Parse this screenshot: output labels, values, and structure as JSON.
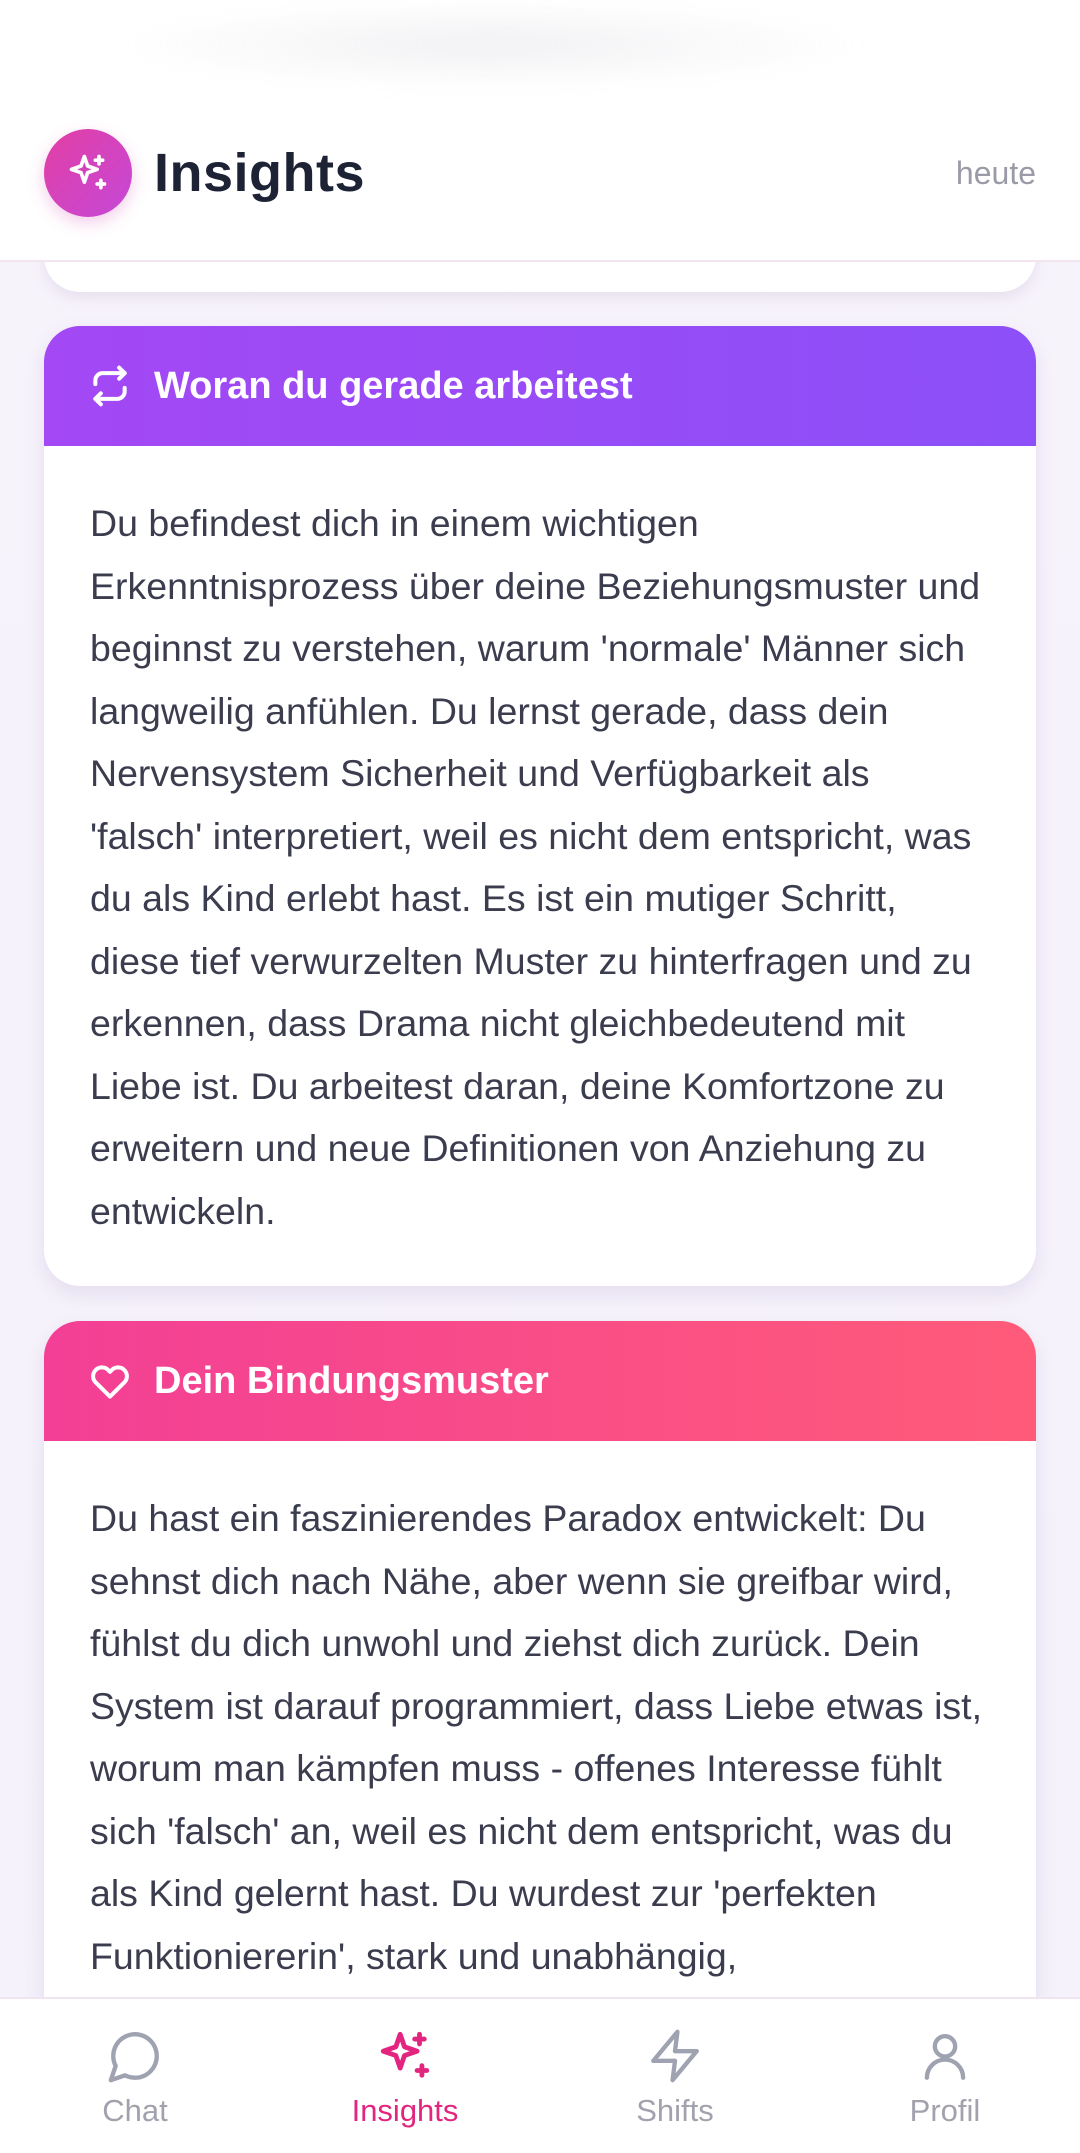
{
  "header": {
    "title": "Insights",
    "date": "heute",
    "logo_icon": "sparkles-icon"
  },
  "cards": [
    {
      "icon": "repeat-icon",
      "title": "Woran du gerade arbeitest",
      "color_from": "#a348f4",
      "color_to": "#8c4ff8",
      "body": "Du befindest dich in einem wichtigen Erkenntnisprozess über deine Beziehungsmuster und beginnst zu verstehen, warum 'normale' Männer sich langweilig anfühlen. Du lernst gerade, dass dein Nervensystem Sicherheit und Verfügbarkeit als 'falsch' interpretiert, weil es nicht dem entspricht, was du als Kind erlebt hast. Es ist ein mutiger Schritt, diese tief verwurzelten Muster zu hinterfragen und zu erkennen, dass Drama nicht gleichbedeutend mit Liebe ist. Du arbeitest daran, deine Komfortzone zu erweitern und neue Definitionen von Anziehung zu entwickeln."
    },
    {
      "icon": "heart-icon",
      "title": "Dein Bindungsmuster",
      "color_from": "#f33f96",
      "color_to": "#ff5b79",
      "body": "Du hast ein faszinierendes Paradox entwickelt: Du sehnst dich nach Nähe, aber wenn sie greifbar wird, fühlst du dich unwohl und ziehst dich zurück. Dein System ist darauf programmiert, dass Liebe etwas ist, worum man kämpfen muss - offenes Interesse fühlt sich 'falsch' an, weil es nicht dem entspricht, was du als Kind gelernt hast. Du wurdest zur 'perfekten Funktioniererin', stark und unabhängig,"
    }
  ],
  "nav": {
    "active": "Insights",
    "active_color": "#e2267f",
    "items": [
      {
        "label": "Chat",
        "icon": "chat-bubble-icon"
      },
      {
        "label": "Insights",
        "icon": "sparkles-icon"
      },
      {
        "label": "Shifts",
        "icon": "lightning-icon"
      },
      {
        "label": "Profil",
        "icon": "user-icon"
      }
    ]
  }
}
